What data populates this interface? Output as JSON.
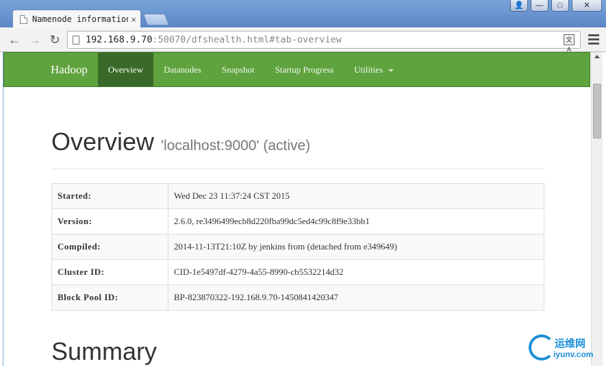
{
  "browser": {
    "tab_title": "Namenode information",
    "tab_close": "×",
    "url_host": "192.168.9.70",
    "url_rest": ":50070/dfshealth.html#tab-overview",
    "window_buttons": {
      "user": "👤",
      "minimize": "—",
      "maximize": "□",
      "close": "✕"
    },
    "translate_icon_label": "文A"
  },
  "navbar": {
    "brand": "Hadoop",
    "items": [
      {
        "label": "Overview",
        "active": true
      },
      {
        "label": "Datanodes"
      },
      {
        "label": "Snapshot"
      },
      {
        "label": "Startup Progress"
      },
      {
        "label": "Utilities",
        "dropdown": true
      }
    ]
  },
  "overview": {
    "title": "Overview",
    "subtitle": "'localhost:9000' (active)",
    "rows": [
      {
        "key": "Started:",
        "value": "Wed Dec 23 11:37:24 CST 2015"
      },
      {
        "key": "Version:",
        "value": "2.6.0, re3496499ecb8d220fba99dc5ed4c99c8f9e33bb1"
      },
      {
        "key": "Compiled:",
        "value": "2014-11-13T21:10Z by jenkins from (detached from e349649)"
      },
      {
        "key": "Cluster ID:",
        "value": "CID-1e5497df-4279-4a55-8990-cb5532214d32"
      },
      {
        "key": "Block Pool ID:",
        "value": "BP-823870322-192.168.9.70-1450841420347"
      }
    ]
  },
  "summary": {
    "title": "Summary"
  },
  "watermark": {
    "line1": "运维网",
    "line2": "iyunv.com"
  },
  "colors": {
    "navbar": "#5fa33e",
    "navbar_active": "#3a6a2a",
    "chrome": "#7aa3d9"
  }
}
